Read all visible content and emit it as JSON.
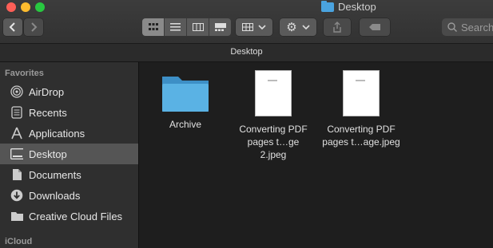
{
  "window": {
    "title": "Desktop"
  },
  "toolbar": {
    "search_placeholder": "Search"
  },
  "pathbar": {
    "title": "Desktop"
  },
  "sidebar": {
    "favorites_header": "Favorites",
    "items": [
      {
        "label": "AirDrop",
        "icon": "airdrop-icon"
      },
      {
        "label": "Recents",
        "icon": "recents-icon"
      },
      {
        "label": "Applications",
        "icon": "applications-icon"
      },
      {
        "label": "Desktop",
        "icon": "desktop-icon",
        "selected": true
      },
      {
        "label": "Documents",
        "icon": "documents-icon"
      },
      {
        "label": "Downloads",
        "icon": "downloads-icon"
      },
      {
        "label": "Creative Cloud Files",
        "icon": "folder-icon"
      }
    ],
    "icloud_header": "iCloud"
  },
  "files": [
    {
      "name": "Archive",
      "type": "folder"
    },
    {
      "name_line1": "Converting PDF",
      "name_line2": "pages t…ge 2.jpeg",
      "type": "image"
    },
    {
      "name_line1": "Converting PDF",
      "name_line2": "pages t…age.jpeg",
      "type": "image"
    }
  ],
  "colors": {
    "selection": "#555555",
    "folder": "#4aa3df",
    "close": "#fe5f57",
    "minimize": "#febc2e",
    "zoom": "#28c840"
  }
}
